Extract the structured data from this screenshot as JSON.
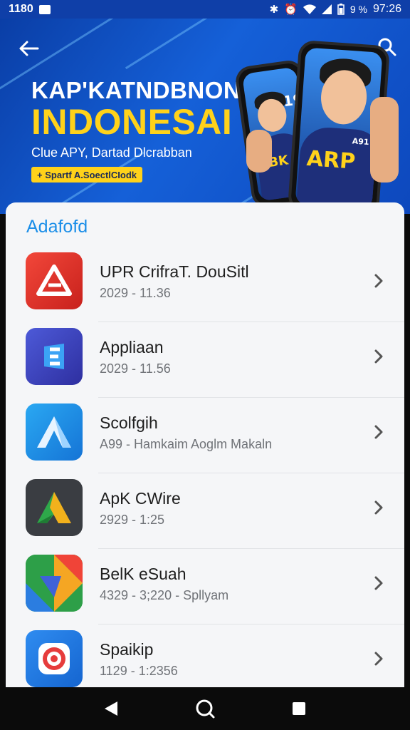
{
  "status_bar": {
    "time": "1180",
    "battery_percent": "9 %",
    "right_time": "97:26"
  },
  "hero": {
    "title_line1": "KAP'KATNDBNONI",
    "title_line2": "INDONESAI",
    "subtitle": "Clue APY, Dartad Dlcrabban",
    "tag": "+ Spartf A.SoectlCIodk",
    "phone_left_text": "19F",
    "phone_left_shirt": "BK",
    "phone_right_shirt": "ARP",
    "phone_right_small": "A91"
  },
  "section": {
    "title": "Adafofd"
  },
  "apps": [
    {
      "title": "UPR CrifraT. DouSitl",
      "subtitle": "2029 - 11.36",
      "icon": "red-a-logo-icon"
    },
    {
      "title": "Appliaan",
      "subtitle": "2029 - 11.56",
      "icon": "blue-3d-e-icon"
    },
    {
      "title": "Scolfgih",
      "subtitle": "A99 - Hamkaim Aoglm Makaln",
      "icon": "blue-a-triangle-icon"
    },
    {
      "title": "ApK CWire",
      "subtitle": "2929 - 1:25",
      "icon": "green-yellow-triangle-icon"
    },
    {
      "title": "BelK eSuah",
      "subtitle": "4329 - 3;220 - Spllyam",
      "icon": "colorful-geometric-icon"
    },
    {
      "title": "Spaikip",
      "subtitle": "1129 - 1:2356",
      "icon": "red-target-icon"
    }
  ],
  "colors": {
    "hero_blue": "#1560d8",
    "accent_yellow": "#ffd21a",
    "section_title": "#1a8ee8",
    "card_bg": "#f5f6f8"
  }
}
